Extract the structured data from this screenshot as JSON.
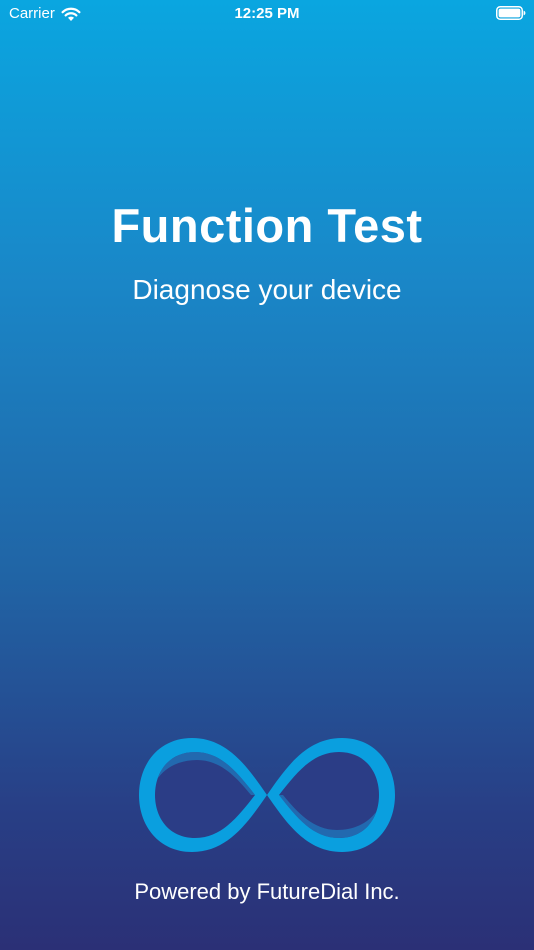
{
  "status_bar": {
    "carrier": "Carrier",
    "time": "12:25 PM",
    "icons": [
      "wifi-icon",
      "battery-icon"
    ]
  },
  "main": {
    "title": "Function Test",
    "subtitle": "Diagnose your device"
  },
  "footer": {
    "logo_icon": "infinity-logo-icon",
    "powered_by": "Powered by FutureDial Inc."
  },
  "colors": {
    "gradient_top": "#0aa6e0",
    "gradient_bottom": "#2b3076",
    "logo_blue": "#0a9fdf",
    "text": "#ffffff"
  }
}
